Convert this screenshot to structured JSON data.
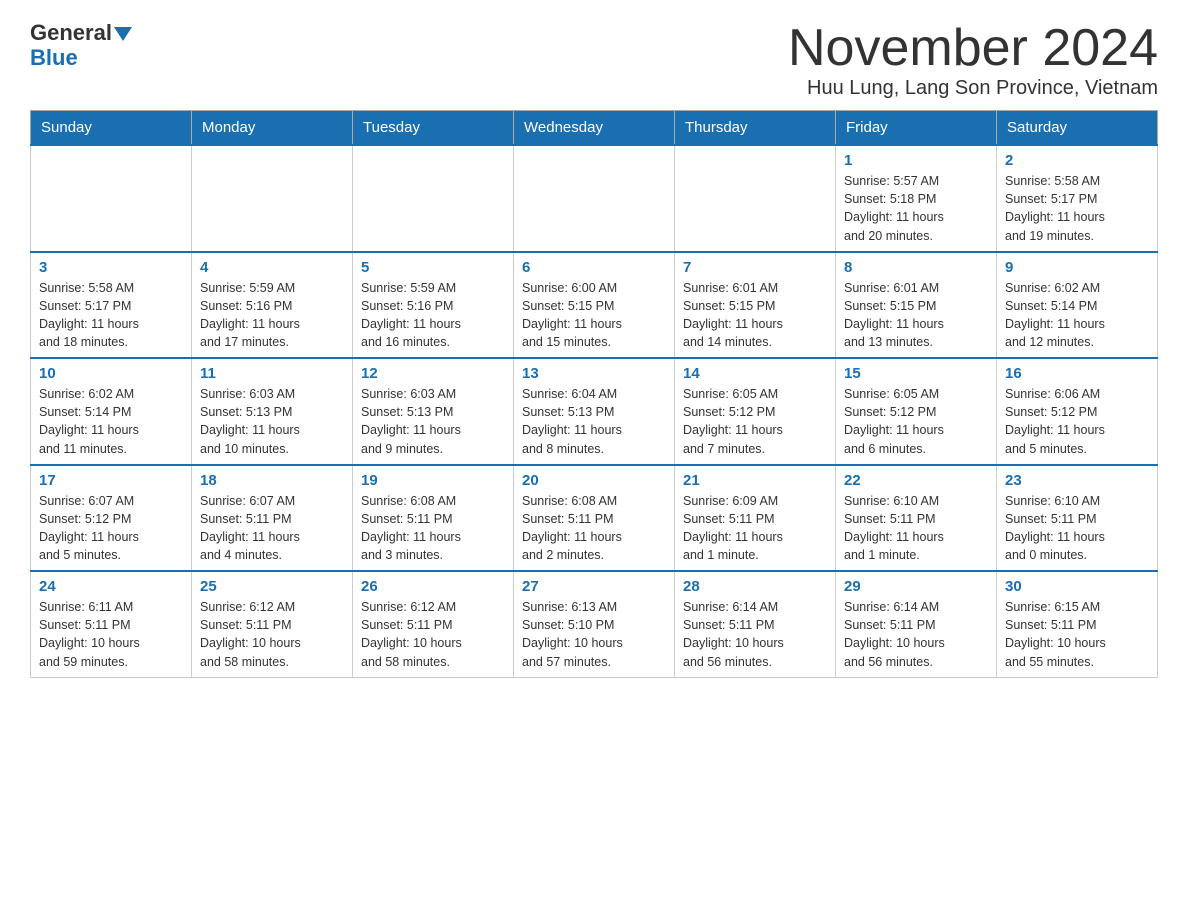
{
  "header": {
    "logo_general": "General",
    "logo_blue": "Blue",
    "title": "November 2024",
    "subtitle": "Huu Lung, Lang Son Province, Vietnam"
  },
  "days_of_week": [
    "Sunday",
    "Monday",
    "Tuesday",
    "Wednesday",
    "Thursday",
    "Friday",
    "Saturday"
  ],
  "weeks": [
    {
      "days": [
        {
          "number": "",
          "info": ""
        },
        {
          "number": "",
          "info": ""
        },
        {
          "number": "",
          "info": ""
        },
        {
          "number": "",
          "info": ""
        },
        {
          "number": "",
          "info": ""
        },
        {
          "number": "1",
          "info": "Sunrise: 5:57 AM\nSunset: 5:18 PM\nDaylight: 11 hours\nand 20 minutes."
        },
        {
          "number": "2",
          "info": "Sunrise: 5:58 AM\nSunset: 5:17 PM\nDaylight: 11 hours\nand 19 minutes."
        }
      ]
    },
    {
      "days": [
        {
          "number": "3",
          "info": "Sunrise: 5:58 AM\nSunset: 5:17 PM\nDaylight: 11 hours\nand 18 minutes."
        },
        {
          "number": "4",
          "info": "Sunrise: 5:59 AM\nSunset: 5:16 PM\nDaylight: 11 hours\nand 17 minutes."
        },
        {
          "number": "5",
          "info": "Sunrise: 5:59 AM\nSunset: 5:16 PM\nDaylight: 11 hours\nand 16 minutes."
        },
        {
          "number": "6",
          "info": "Sunrise: 6:00 AM\nSunset: 5:15 PM\nDaylight: 11 hours\nand 15 minutes."
        },
        {
          "number": "7",
          "info": "Sunrise: 6:01 AM\nSunset: 5:15 PM\nDaylight: 11 hours\nand 14 minutes."
        },
        {
          "number": "8",
          "info": "Sunrise: 6:01 AM\nSunset: 5:15 PM\nDaylight: 11 hours\nand 13 minutes."
        },
        {
          "number": "9",
          "info": "Sunrise: 6:02 AM\nSunset: 5:14 PM\nDaylight: 11 hours\nand 12 minutes."
        }
      ]
    },
    {
      "days": [
        {
          "number": "10",
          "info": "Sunrise: 6:02 AM\nSunset: 5:14 PM\nDaylight: 11 hours\nand 11 minutes."
        },
        {
          "number": "11",
          "info": "Sunrise: 6:03 AM\nSunset: 5:13 PM\nDaylight: 11 hours\nand 10 minutes."
        },
        {
          "number": "12",
          "info": "Sunrise: 6:03 AM\nSunset: 5:13 PM\nDaylight: 11 hours\nand 9 minutes."
        },
        {
          "number": "13",
          "info": "Sunrise: 6:04 AM\nSunset: 5:13 PM\nDaylight: 11 hours\nand 8 minutes."
        },
        {
          "number": "14",
          "info": "Sunrise: 6:05 AM\nSunset: 5:12 PM\nDaylight: 11 hours\nand 7 minutes."
        },
        {
          "number": "15",
          "info": "Sunrise: 6:05 AM\nSunset: 5:12 PM\nDaylight: 11 hours\nand 6 minutes."
        },
        {
          "number": "16",
          "info": "Sunrise: 6:06 AM\nSunset: 5:12 PM\nDaylight: 11 hours\nand 5 minutes."
        }
      ]
    },
    {
      "days": [
        {
          "number": "17",
          "info": "Sunrise: 6:07 AM\nSunset: 5:12 PM\nDaylight: 11 hours\nand 5 minutes."
        },
        {
          "number": "18",
          "info": "Sunrise: 6:07 AM\nSunset: 5:11 PM\nDaylight: 11 hours\nand 4 minutes."
        },
        {
          "number": "19",
          "info": "Sunrise: 6:08 AM\nSunset: 5:11 PM\nDaylight: 11 hours\nand 3 minutes."
        },
        {
          "number": "20",
          "info": "Sunrise: 6:08 AM\nSunset: 5:11 PM\nDaylight: 11 hours\nand 2 minutes."
        },
        {
          "number": "21",
          "info": "Sunrise: 6:09 AM\nSunset: 5:11 PM\nDaylight: 11 hours\nand 1 minute."
        },
        {
          "number": "22",
          "info": "Sunrise: 6:10 AM\nSunset: 5:11 PM\nDaylight: 11 hours\nand 1 minute."
        },
        {
          "number": "23",
          "info": "Sunrise: 6:10 AM\nSunset: 5:11 PM\nDaylight: 11 hours\nand 0 minutes."
        }
      ]
    },
    {
      "days": [
        {
          "number": "24",
          "info": "Sunrise: 6:11 AM\nSunset: 5:11 PM\nDaylight: 10 hours\nand 59 minutes."
        },
        {
          "number": "25",
          "info": "Sunrise: 6:12 AM\nSunset: 5:11 PM\nDaylight: 10 hours\nand 58 minutes."
        },
        {
          "number": "26",
          "info": "Sunrise: 6:12 AM\nSunset: 5:11 PM\nDaylight: 10 hours\nand 58 minutes."
        },
        {
          "number": "27",
          "info": "Sunrise: 6:13 AM\nSunset: 5:10 PM\nDaylight: 10 hours\nand 57 minutes."
        },
        {
          "number": "28",
          "info": "Sunrise: 6:14 AM\nSunset: 5:11 PM\nDaylight: 10 hours\nand 56 minutes."
        },
        {
          "number": "29",
          "info": "Sunrise: 6:14 AM\nSunset: 5:11 PM\nDaylight: 10 hours\nand 56 minutes."
        },
        {
          "number": "30",
          "info": "Sunrise: 6:15 AM\nSunset: 5:11 PM\nDaylight: 10 hours\nand 55 minutes."
        }
      ]
    }
  ]
}
